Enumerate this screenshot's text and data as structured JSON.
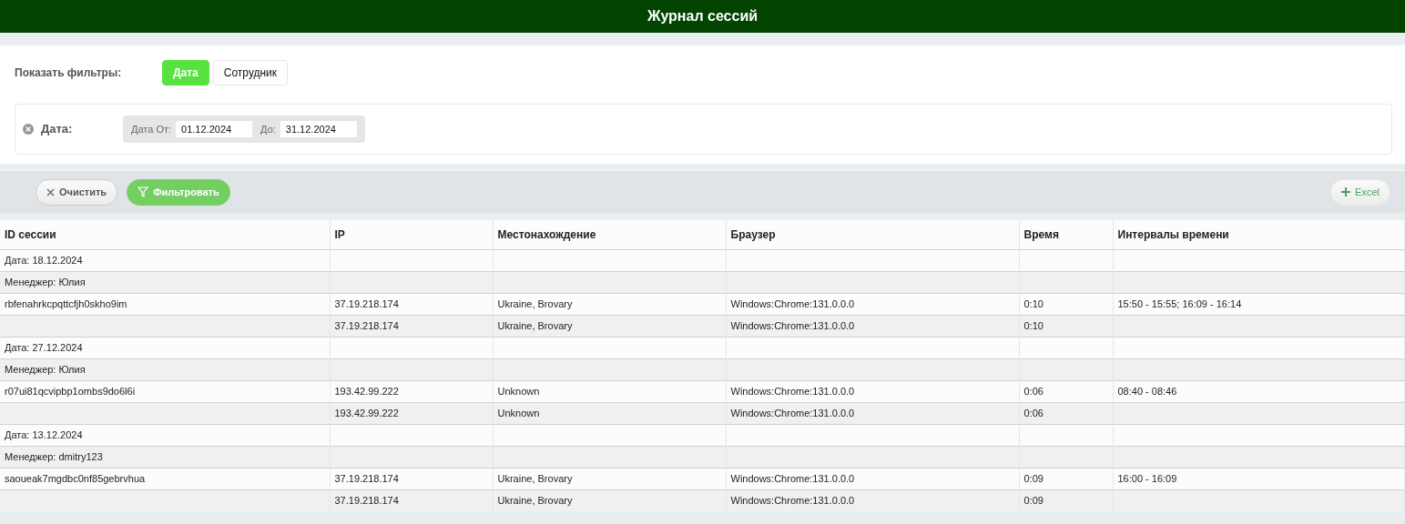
{
  "header": {
    "title": "Журнал сессий"
  },
  "filters": {
    "label": "Показать фильтры:",
    "tabs": [
      {
        "label": "Дата",
        "selected": true
      },
      {
        "label": "Сотрудник",
        "selected": false
      }
    ],
    "date_filter": {
      "label": "Дата:",
      "from_label": "Дата От:",
      "from_value": "01.12.2024",
      "to_label": "До:",
      "to_value": "31.12.2024"
    }
  },
  "toolbar": {
    "clear": "Очистить",
    "filter": "Фильтровать",
    "export": "Excel"
  },
  "table": {
    "columns": [
      "ID сессии",
      "IP",
      "Местонахождение",
      "Браузер",
      "Время",
      "Интервалы времени"
    ],
    "rows": [
      {
        "kind": "group",
        "label": "Дата: 18.12.2024"
      },
      {
        "kind": "group",
        "label": "Менеджер: Юлия"
      },
      {
        "kind": "session",
        "session_id": "rbfenahrkcpqttcfjh0skho9im",
        "ip": "37.19.218.174",
        "location": "Ukraine, Brovary",
        "browser": "Windows:Chrome:131.0.0.0",
        "time": "0:10",
        "intervals": "15:50 - 15:55; 16:09 - 16:14"
      },
      {
        "kind": "session",
        "ip": "37.19.218.174",
        "location": "Ukraine, Brovary",
        "browser": "Windows:Chrome:131.0.0.0",
        "time": "0:10"
      },
      {
        "kind": "group",
        "label": "Дата: 27.12.2024"
      },
      {
        "kind": "group",
        "label": "Менеджер: Юлия"
      },
      {
        "kind": "session",
        "session_id": "r07ui81qcvipbp1ombs9do6l6i",
        "ip": "193.42.99.222",
        "location": "Unknown",
        "browser": "Windows:Chrome:131.0.0.0",
        "time": "0:06",
        "intervals": "08:40 - 08:46"
      },
      {
        "kind": "session",
        "ip": "193.42.99.222",
        "location": "Unknown",
        "browser": "Windows:Chrome:131.0.0.0",
        "time": "0:06"
      },
      {
        "kind": "group",
        "label": "Дата: 13.12.2024"
      },
      {
        "kind": "group",
        "label": "Менеджер: dmitry123"
      },
      {
        "kind": "session",
        "session_id": "saoueak7mgdbc0nf85gebrvhua",
        "ip": "37.19.218.174",
        "location": "Ukraine, Brovary",
        "browser": "Windows:Chrome:131.0.0.0",
        "time": "0:09",
        "intervals": "16:00 - 16:09"
      },
      {
        "kind": "session",
        "ip": "37.19.218.174",
        "location": "Ukraine, Brovary",
        "browser": "Windows:Chrome:131.0.0.0",
        "time": "0:09"
      }
    ]
  }
}
